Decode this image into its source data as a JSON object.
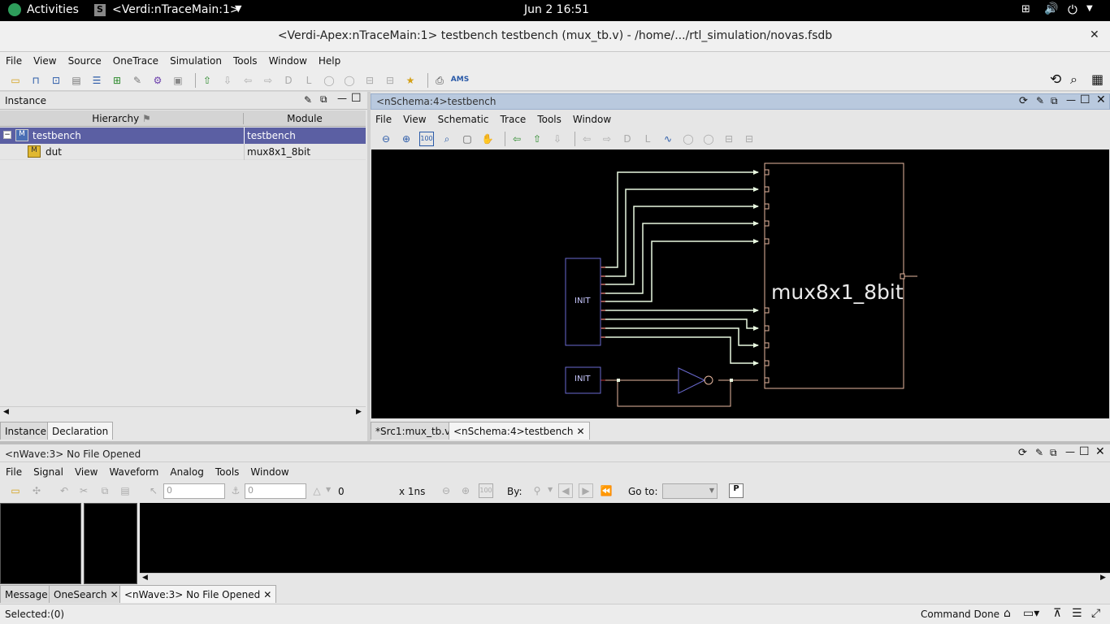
{
  "system_bar": {
    "activities": "Activities",
    "app": "<Verdi:nTraceMain:1>",
    "clock": "Jun 2  16:51"
  },
  "window": {
    "title": "<Verdi-Apex:nTraceMain:1> testbench testbench (mux_tb.v) - /home/.../rtl_simulation/novas.fsdb",
    "close": "✕"
  },
  "main_menu": [
    "File",
    "View",
    "Source",
    "OneTrace",
    "Simulation",
    "Tools",
    "Window",
    "Help"
  ],
  "instance_pane": {
    "title": "Instance",
    "col_hierarchy": "Hierarchy",
    "col_module": "Module",
    "rows": [
      {
        "name": "testbench",
        "module": "testbench",
        "expander": "−"
      },
      {
        "name": "dut",
        "module": "mux8x1_8bit",
        "expander": ""
      }
    ],
    "tabs": [
      "Instance",
      "Declaration"
    ]
  },
  "schema_pane": {
    "title": "<nSchema:4>testbench",
    "menu": [
      "File",
      "View",
      "Schematic",
      "Trace",
      "Tools",
      "Window"
    ],
    "zoom_label": "100",
    "module_name": "mux8x1_8bit",
    "init1": "INIT",
    "init2": "INIT",
    "tabs": [
      "*Src1:mux_tb.v",
      "<nSchema:4>testbench"
    ]
  },
  "wave_pane": {
    "title": "<nWave:3> No File Opened",
    "menu": [
      "File",
      "Signal",
      "View",
      "Waveform",
      "Analog",
      "Tools",
      "Window"
    ],
    "cursor_value": "0",
    "marker_value": "0",
    "delta": "0",
    "unit": "x 1ns",
    "zoom_label": "100",
    "by_label": "By:",
    "goto_label": "Go to:",
    "p_label": "P"
  },
  "bottom_tabs": [
    "Message",
    "OneSearch",
    "<nWave:3> No File Opened"
  ],
  "status": {
    "selected": "Selected:(0)",
    "command": "Command Done"
  },
  "toolbar_ams": "AMS",
  "colors": {
    "accent": "#5b5fa3",
    "wire": "#e8f8e0",
    "module_border": "#e8b8a0",
    "init_border": "#6a6ad0"
  }
}
